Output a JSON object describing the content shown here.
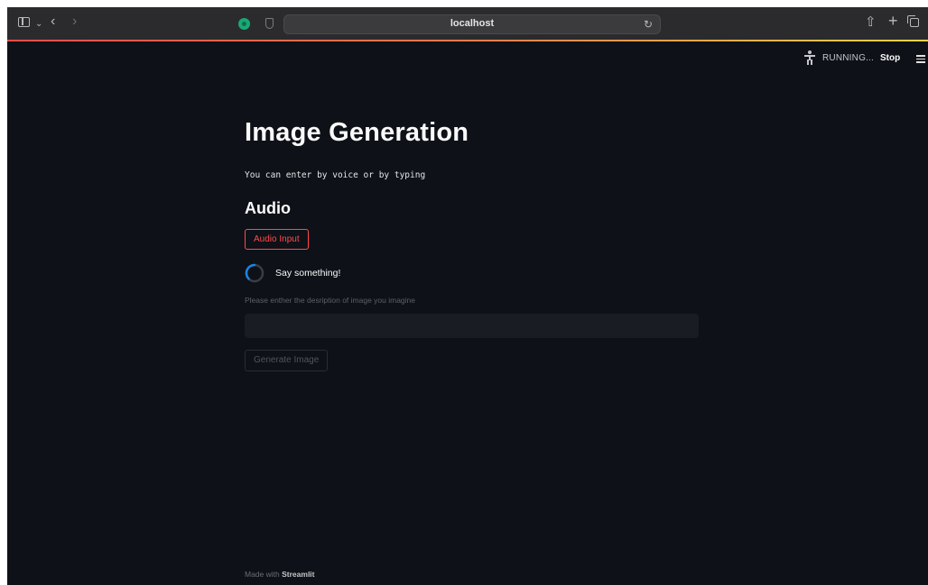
{
  "browser": {
    "address": "localhost"
  },
  "header": {
    "status": "RUNNING...",
    "stop_label": "Stop"
  },
  "main": {
    "title": "Image Generation",
    "subtitle": "You can enter by voice or by typing",
    "section_heading": "Audio",
    "audio_button_label": "Audio Input",
    "spinner_text": "Say something!",
    "input_label": "Please enther the desription of image you imagine",
    "input_value": "",
    "generate_button_label": "Generate Image"
  },
  "footer": {
    "prefix": "Made with",
    "brand": "Streamlit"
  },
  "colors": {
    "background": "#0e1117",
    "accent": "#ff4b4b",
    "spinner": "#1c83e1",
    "text": "#fafafa"
  }
}
